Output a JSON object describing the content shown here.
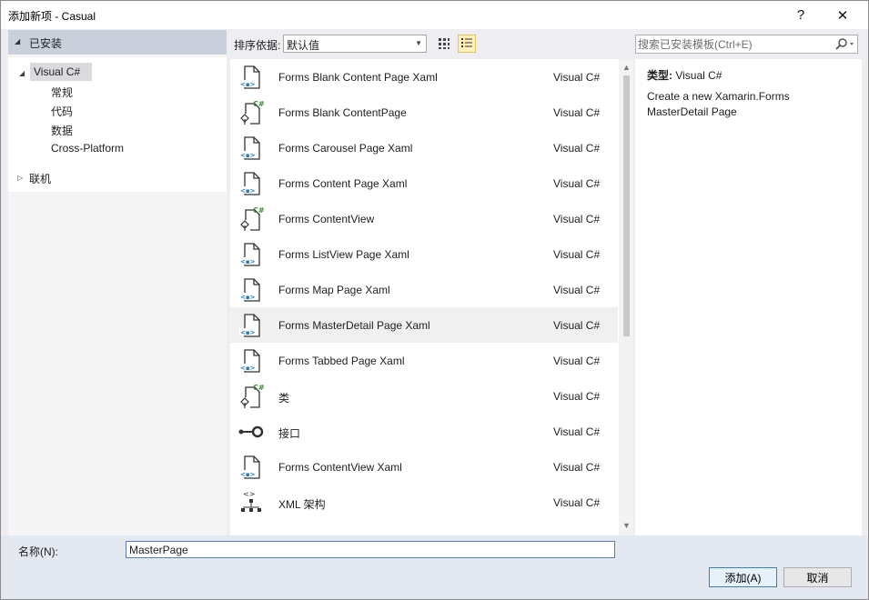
{
  "window": {
    "title": "添加新项 - Casual",
    "help_glyph": "?",
    "close_glyph": "✕"
  },
  "tree": {
    "installed_label": "已安装",
    "root_label": "Visual C#",
    "children": [
      "常规",
      "代码",
      "数据",
      "Cross-Platform"
    ],
    "online_label": "联机"
  },
  "toolbar": {
    "sort_label": "排序依据:",
    "sort_value": "默认值"
  },
  "search": {
    "placeholder": "搜索已安装模板(Ctrl+E)"
  },
  "templates": [
    {
      "name": "Forms Blank Content Page Xaml",
      "type": "Visual C#",
      "icon": "xaml-file-icon"
    },
    {
      "name": "Forms Blank ContentPage",
      "type": "Visual C#",
      "icon": "csharp-file-icon"
    },
    {
      "name": "Forms Carousel Page Xaml",
      "type": "Visual C#",
      "icon": "xaml-file-icon"
    },
    {
      "name": "Forms Content Page Xaml",
      "type": "Visual C#",
      "icon": "xaml-file-icon"
    },
    {
      "name": "Forms ContentView",
      "type": "Visual C#",
      "icon": "csharp-file-icon"
    },
    {
      "name": "Forms ListView Page Xaml",
      "type": "Visual C#",
      "icon": "xaml-file-icon"
    },
    {
      "name": "Forms Map Page Xaml",
      "type": "Visual C#",
      "icon": "xaml-file-icon"
    },
    {
      "name": "Forms MasterDetail Page Xaml",
      "type": "Visual C#",
      "icon": "xaml-file-icon",
      "selected": true
    },
    {
      "name": "Forms Tabbed Page Xaml",
      "type": "Visual C#",
      "icon": "xaml-file-icon"
    },
    {
      "name": "类",
      "type": "Visual C#",
      "icon": "csharp-file-icon"
    },
    {
      "name": "接口",
      "type": "Visual C#",
      "icon": "interface-icon"
    },
    {
      "name": "Forms ContentView Xaml",
      "type": "Visual C#",
      "icon": "xaml-file-icon"
    },
    {
      "name": "XML 架构",
      "type": "Visual C#",
      "icon": "xml-schema-icon"
    }
  ],
  "details": {
    "type_label": "类型:",
    "type_value": "Visual C#",
    "description": "Create a new Xamarin.Forms MasterDetail Page"
  },
  "bottom": {
    "name_label": "名称(N):",
    "name_value": "MasterPage",
    "add_label": "添加(A)",
    "cancel_label": "取消"
  }
}
